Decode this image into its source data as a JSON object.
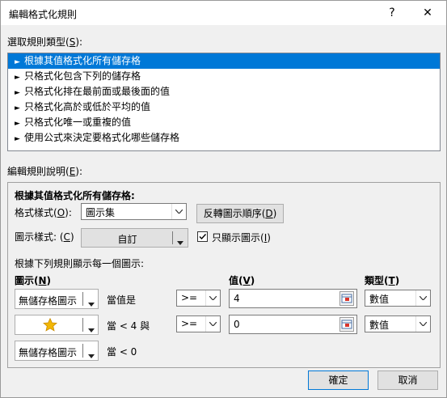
{
  "window": {
    "title": "編輯格式化規則",
    "help_glyph": "?",
    "close_glyph": "✕"
  },
  "rule_type": {
    "label": "選取規則類型(",
    "accel": "S",
    "label_end": "):",
    "items": [
      "根據其值格式化所有儲存格",
      "只格式化包含下列的儲存格",
      "只格式化排在最前面或最後面的值",
      "只格式化高於或低於平均的值",
      "只格式化唯一或重複的值",
      "使用公式來決定要格式化哪些儲存格"
    ],
    "selected_index": 0
  },
  "description": {
    "label": "編輯規則說明(",
    "accel": "E",
    "label_end": "):",
    "heading": "根據其值格式化所有儲存格:",
    "format_style_label": "格式樣式(",
    "format_style_accel": "O",
    "format_style_end": "):",
    "format_style_value": "圖示集",
    "reverse_button": "反轉圖示順序(",
    "reverse_accel": "D",
    "reverse_end": ")",
    "icon_style_label": "圖示樣式: (",
    "icon_style_accel": "C",
    "icon_style_end": ")",
    "icon_style_value": "自訂",
    "show_icon_only_label": "只顯示圖示(",
    "show_icon_only_accel": "I",
    "show_icon_only_end": ")",
    "show_icon_only_checked": true,
    "rules_caption": "根據下列規則顯示每一個圖示:",
    "col_icon": "圖示(",
    "col_icon_accel": "N",
    "col_icon_end": ")",
    "col_value": "值(",
    "col_value_accel": "V",
    "col_value_end": ")",
    "col_type": "類型(",
    "col_type_accel": "T",
    "col_type_end": ")",
    "rows": [
      {
        "icon": "無儲存格圖示",
        "condition": "當值是",
        "operator": ">=",
        "value": "4",
        "type": "數值"
      },
      {
        "icon": "star-icon",
        "condition": "當 < 4 與",
        "operator": ">=",
        "value": "0",
        "type": "數值"
      },
      {
        "icon": "無儲存格圖示",
        "condition": "當 < 0"
      }
    ]
  },
  "footer": {
    "ok": "確定",
    "cancel": "取消"
  },
  "colors": {
    "selection": "#0078d7",
    "star": "#f2b705"
  }
}
